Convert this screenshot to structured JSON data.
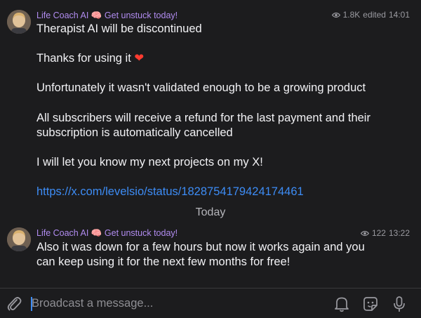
{
  "messages": [
    {
      "sender": "Life Coach AI",
      "sender_emoji": "🧠",
      "sender_tagline": "Get unstuck today!",
      "views": "1.8K",
      "edited": "edited",
      "time": "14:01",
      "lines": [
        "Therapist AI will be discontinued",
        "Thanks for using it",
        "Unfortunately it wasn't validated enough to be a growing product",
        "All subscribers will receive a refund for the last payment and their",
        "subscription is automatically cancelled",
        "I will let you know my next projects on my X!"
      ],
      "heart": "❤",
      "link": "https://x.com/levelsio/status/1828754179424174461"
    },
    {
      "sender": "Life Coach AI",
      "sender_emoji": "🧠",
      "sender_tagline": "Get unstuck today!",
      "views": "122",
      "time": "13:22",
      "lines": [
        "Also it was down for a few hours but now it works again and you",
        "can keep using it for the next few months for free!"
      ]
    }
  ],
  "date_divider": "Today",
  "input": {
    "placeholder": "Broadcast a message..."
  },
  "colors": {
    "background": "#1c1c1e",
    "sender": "#b18cf0",
    "link": "#3d8cf5",
    "meta": "#9a9aa0"
  },
  "icons": [
    "eye-icon",
    "paperclip-icon",
    "bell-icon",
    "sticker-icon",
    "microphone-icon"
  ]
}
